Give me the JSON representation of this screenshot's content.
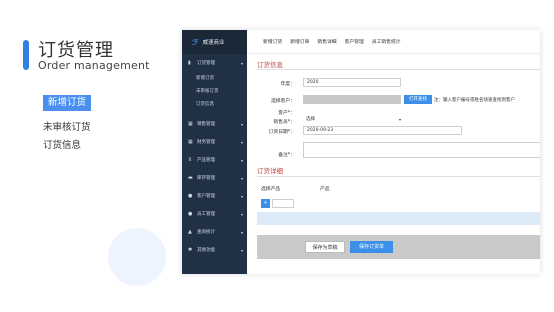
{
  "intro": {
    "title_cn": "订货管理",
    "title_en": "Order management",
    "menu": [
      "新增订货",
      "未审核订货",
      "订货信息"
    ]
  },
  "app": {
    "brand": "威速商业",
    "sidebar": [
      {
        "icon": "doc-icon",
        "label": "订货管理",
        "subitems": [
          "新增订货",
          "未审核订货",
          "订货信息"
        ]
      },
      {
        "icon": "grid-icon",
        "label": "销售管理"
      },
      {
        "icon": "grid-icon",
        "label": "财务管理"
      },
      {
        "icon": "cart-icon",
        "label": "产品管理"
      },
      {
        "icon": "box-icon",
        "label": "库存管理"
      },
      {
        "icon": "user-icon",
        "label": "客户管理"
      },
      {
        "icon": "people-icon",
        "label": "员工管理"
      },
      {
        "icon": "chart-icon",
        "label": "查询统计"
      },
      {
        "icon": "gear-icon",
        "label": "其他功能"
      }
    ],
    "topnav": [
      "新增订货",
      "新增订单",
      "销售详细",
      "客户管理",
      "员工销售统计"
    ],
    "form": {
      "section_info": "订货信息",
      "year_label": "年度：",
      "year_value": "2020",
      "customer_label": "选择客户：",
      "find_button": "打开查找",
      "note": "注：输入客户编号或姓名快速查找到客户",
      "customer2_label": "客户*：",
      "sales_label": "销售员*：",
      "sales_value": "选择",
      "date_label": "订货日期*：",
      "date_value": "2020-09-23",
      "remark_label": "备注*：",
      "section_detail": "订货详细",
      "col_select": "选择产品",
      "col_product": "产品",
      "plus": "+",
      "draft_button": "保存为草稿",
      "save_button": "保存订货单"
    }
  }
}
